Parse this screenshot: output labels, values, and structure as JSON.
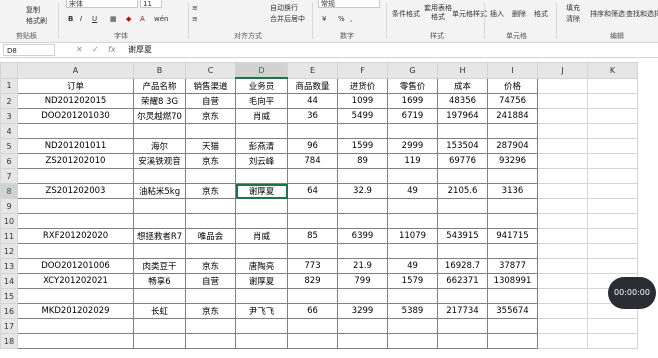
{
  "ribbon": {
    "clipboard": {
      "copy": "复制",
      "format_painter": "格式刷",
      "group": "剪贴板"
    },
    "font": {
      "font_name": "宋体",
      "font_size": "11",
      "bold": "B",
      "italic": "I",
      "underline": "U",
      "font_color_glyph": "A",
      "wen": "wén",
      "group": "字体"
    },
    "alignment": {
      "wrap": "自动换行",
      "merge": "合并后居中",
      "group": "对齐方式"
    },
    "number": {
      "format": "常规",
      "percent": "%",
      "comma": ",",
      "group": "数字"
    },
    "styles": {
      "conditional": "条件格式",
      "table": "套用表格格式",
      "cell_styles": "单元格样式",
      "group": "样式"
    },
    "cells": {
      "insert": "插入",
      "delete": "删除",
      "format": "格式",
      "group": "单元格"
    },
    "editing": {
      "fill": "填充",
      "clear": "清除",
      "sort": "排序和筛选",
      "find": "查找和选择",
      "group": "编辑"
    }
  },
  "formula_bar": {
    "name_box": "D8",
    "cancel": "✕",
    "confirm": "✓",
    "fx": "fx",
    "content": "谢厚夏"
  },
  "sheet": {
    "columns": [
      "A",
      "B",
      "C",
      "D",
      "E",
      "F",
      "G",
      "H",
      "I",
      "J",
      "K"
    ],
    "selected_column": "D",
    "selected_row": "8",
    "rows": [
      {
        "num": "1",
        "cells": [
          "订单",
          "产品名称",
          "销售渠道",
          "业务员",
          "商品数量",
          "进货价",
          "零售价",
          "成本",
          "价格",
          "",
          ""
        ]
      },
      {
        "num": "2",
        "cells": [
          "ND201202015",
          "荣耀8 3G",
          "自营",
          "毛向平",
          "44",
          "1099",
          "1699",
          "48356",
          "74756",
          "",
          ""
        ]
      },
      {
        "num": "3",
        "cells": [
          "DOO201201030",
          "尔灵越燃70",
          "京东",
          "肖威",
          "36",
          "5499",
          "6719",
          "197964",
          "241884",
          "",
          ""
        ]
      },
      {
        "num": "4",
        "cells": [
          "",
          "",
          "",
          "",
          "",
          "",
          "",
          "",
          "",
          "",
          ""
        ]
      },
      {
        "num": "5",
        "cells": [
          "ND201201011",
          "海尔",
          "天猫",
          "彭燕清",
          "96",
          "1599",
          "2999",
          "153504",
          "287904",
          "",
          ""
        ]
      },
      {
        "num": "6",
        "cells": [
          "ZS201202010",
          "安溪铁观音",
          "京东",
          "刘云峰",
          "784",
          "89",
          "119",
          "69776",
          "93296",
          "",
          ""
        ]
      },
      {
        "num": "7",
        "cells": [
          "",
          "",
          "",
          "",
          "",
          "",
          "",
          "",
          "",
          "",
          ""
        ]
      },
      {
        "num": "8",
        "cells": [
          "ZS201202003",
          "油粘米5kg",
          "京东",
          "谢厚夏",
          "64",
          "32.9",
          "49",
          "2105.6",
          "3136",
          "",
          ""
        ]
      },
      {
        "num": "9",
        "cells": [
          "",
          "",
          "",
          "",
          "",
          "",
          "",
          "",
          "",
          "",
          ""
        ]
      },
      {
        "num": "10",
        "cells": [
          "",
          "",
          "",
          "",
          "",
          "",
          "",
          "",
          "",
          "",
          ""
        ]
      },
      {
        "num": "11",
        "cells": [
          "RXF201202020",
          "想拯救者R7",
          "唯品会",
          "肖威",
          "85",
          "6399",
          "11079",
          "543915",
          "941715",
          "",
          ""
        ]
      },
      {
        "num": "12",
        "cells": [
          "",
          "",
          "",
          "",
          "",
          "",
          "",
          "",
          "",
          "",
          ""
        ]
      },
      {
        "num": "13",
        "cells": [
          "DOO201201006",
          "肉类豆干",
          "京东",
          "唐陶亮",
          "773",
          "21.9",
          "49",
          "16928.7",
          "37877",
          "",
          ""
        ]
      },
      {
        "num": "14",
        "cells": [
          "XCY201202021",
          "畅享6",
          "自营",
          "谢厚夏",
          "829",
          "799",
          "1579",
          "662371",
          "1308991",
          "",
          ""
        ]
      },
      {
        "num": "15",
        "cells": [
          "",
          "",
          "",
          "",
          "",
          "",
          "",
          "",
          "",
          "",
          ""
        ]
      },
      {
        "num": "16",
        "cells": [
          "MKD201202029",
          "长虹",
          "京东",
          "尹飞飞",
          "66",
          "3299",
          "5389",
          "217734",
          "355674",
          "",
          ""
        ]
      },
      {
        "num": "17",
        "cells": [
          "",
          "",
          "",
          "",
          "",
          "",
          "",
          "",
          "",
          "",
          ""
        ]
      },
      {
        "num": "18",
        "cells": [
          "",
          "",
          "",
          "",
          "",
          "",
          "",
          "",
          "",
          "",
          ""
        ]
      }
    ]
  },
  "video": {
    "time": "00:00:00"
  }
}
